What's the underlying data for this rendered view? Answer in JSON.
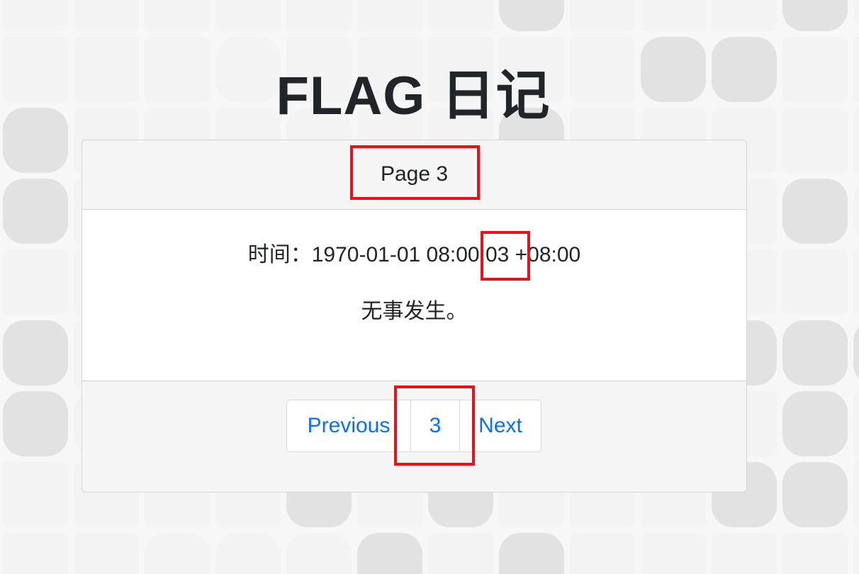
{
  "page": {
    "title": "FLAG 日记"
  },
  "card": {
    "header": "Page 3",
    "time_line": "时间：1970-01-01 08:00:03 +08:00",
    "event_text": "无事发生。"
  },
  "pagination": {
    "previous_label": "Previous",
    "current_page": "3",
    "next_label": "Next"
  },
  "colors": {
    "link": "#0d6efd",
    "highlight": "#e8101a",
    "card_header_bg": "#f5f5f5",
    "background_tile_light": "#f3f3f3",
    "background_tile_dark": "#e2e2e2"
  }
}
